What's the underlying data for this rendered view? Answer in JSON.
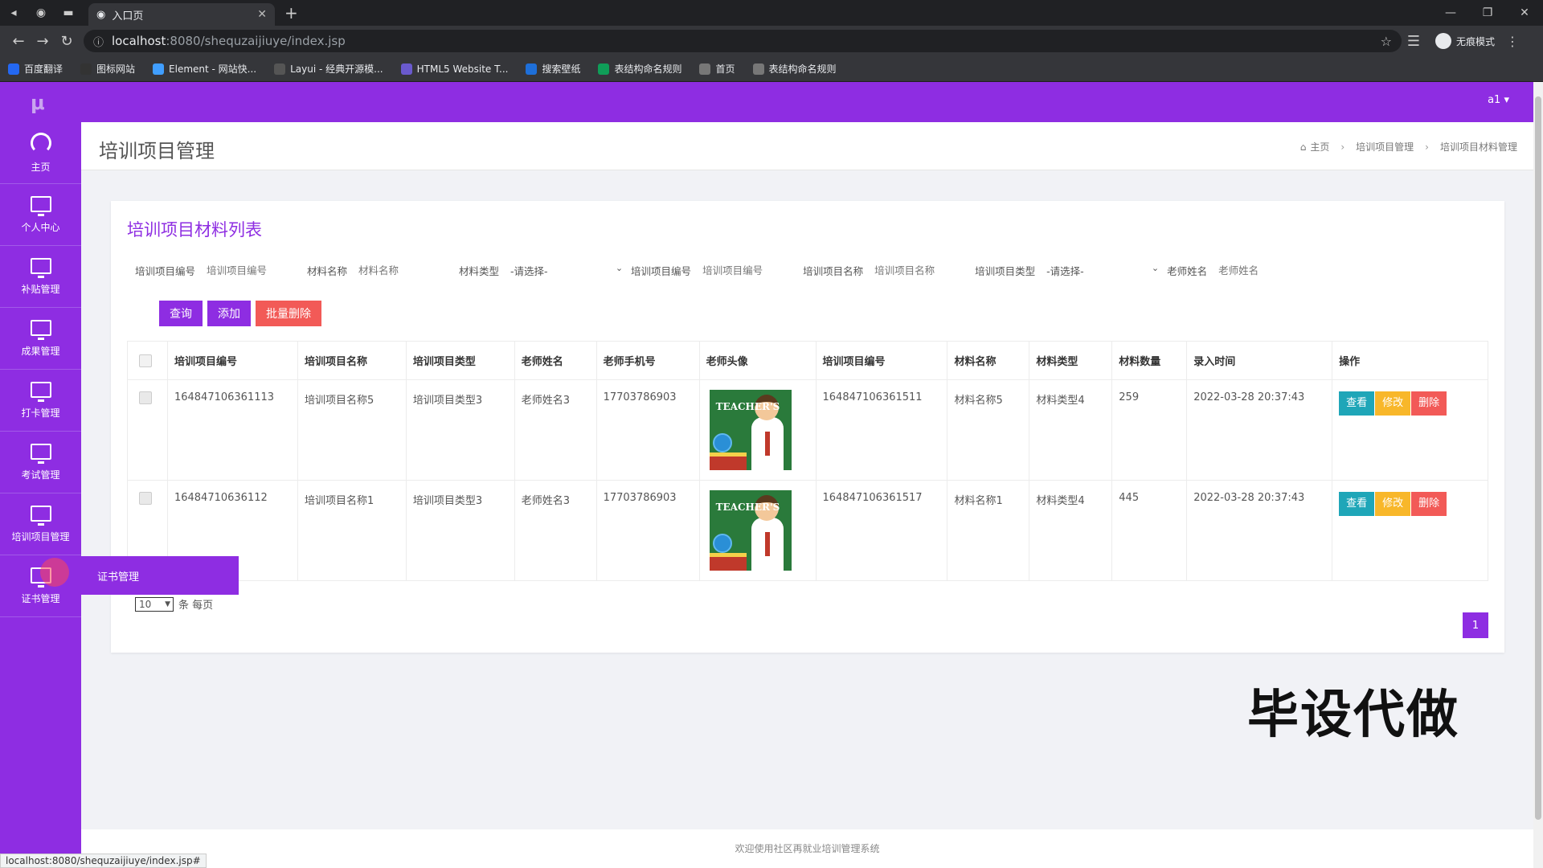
{
  "browser": {
    "tab_title": "入口页",
    "url_host": "localhost",
    "url_path": ":8080/shequzaijiuye/index.jsp",
    "incognito_label": "无痕模式",
    "status_url": "localhost:8080/shequzaijiuye/index.jsp#",
    "bookmarks": [
      {
        "label": "百度翻译",
        "color": "#2468f2"
      },
      {
        "label": "图标网站",
        "color": "#333333"
      },
      {
        "label": "Element - 网站快...",
        "color": "#409eff"
      },
      {
        "label": "Layui - 经典开源模...",
        "color": "#555555"
      },
      {
        "label": "HTML5 Website T...",
        "color": "#6a5acd"
      },
      {
        "label": "搜索壁纸",
        "color": "#1e6fd9"
      },
      {
        "label": "表结构命名规则",
        "color": "#0f9d58"
      },
      {
        "label": "首页",
        "color": "#777777"
      },
      {
        "label": "表结构命名规则",
        "color": "#777777"
      }
    ]
  },
  "app": {
    "logo": "μ",
    "user": "a1 ▾",
    "accent_color": "#8e2de2",
    "sidebar": [
      {
        "label": "主页",
        "icon": "dashboard-icon"
      },
      {
        "label": "个人中心",
        "icon": "monitor-icon"
      },
      {
        "label": "补贴管理",
        "icon": "monitor-icon"
      },
      {
        "label": "成果管理",
        "icon": "monitor-icon"
      },
      {
        "label": "打卡管理",
        "icon": "monitor-icon"
      },
      {
        "label": "考试管理",
        "icon": "monitor-icon"
      },
      {
        "label": "培训项目管理",
        "icon": "monitor-icon"
      },
      {
        "label": "证书管理",
        "icon": "monitor-icon"
      }
    ],
    "flyout_item": "证书管理",
    "page_title": "培训项目管理",
    "breadcrumb": [
      "主页",
      "培训项目管理",
      "培训项目材料管理"
    ],
    "card_title": "培训项目材料列表",
    "search": {
      "fields": [
        {
          "label": "培训项目编号",
          "placeholder": "培训项目编号",
          "type": "input"
        },
        {
          "label": "材料名称",
          "placeholder": "材料名称",
          "type": "input"
        },
        {
          "label": "材料类型",
          "value": "-请选择-",
          "type": "select"
        },
        {
          "label": "培训项目编号",
          "placeholder": "培训项目编号",
          "type": "input"
        },
        {
          "label": "培训项目名称",
          "placeholder": "培训项目名称",
          "type": "input"
        },
        {
          "label": "培训项目类型",
          "value": "-请选择-",
          "type": "select"
        },
        {
          "label": "老师姓名",
          "placeholder": "老师姓名",
          "type": "input"
        }
      ]
    },
    "buttons": {
      "query": "查询",
      "add": "添加",
      "batch_delete": "批量删除"
    },
    "table": {
      "headers": [
        "培训项目编号",
        "培训项目名称",
        "培训项目类型",
        "老师姓名",
        "老师手机号",
        "老师头像",
        "培训项目编号",
        "材料名称",
        "材料类型",
        "材料数量",
        "录入时间",
        "操作"
      ],
      "rows": [
        {
          "project_no": "164847106361113",
          "project_name": "培训项目名称5",
          "project_type": "培训项目类型3",
          "teacher": "老师姓名3",
          "phone": "17703786903",
          "project_no2": "164847106361511",
          "material_name": "材料名称5",
          "material_type": "材料类型4",
          "qty": "259",
          "time": "2022-03-28 20:37:43"
        },
        {
          "project_no": "16484710636112",
          "project_name": "培训项目名称1",
          "project_type": "培训项目类型3",
          "teacher": "老师姓名3",
          "phone": "17703786903",
          "project_no2": "164847106361517",
          "material_name": "材料名称1",
          "material_type": "材料类型4",
          "qty": "445",
          "time": "2022-03-28 20:37:43"
        }
      ],
      "avatar_text": "TEACHER'S",
      "actions": {
        "view": "查看",
        "edit": "修改",
        "delete": "删除"
      }
    },
    "pager": {
      "page_size": "10",
      "per_page_label": "条 每页",
      "current_page": "1"
    },
    "footer": "欢迎使用社区再就业培训管理系统"
  },
  "watermark": "毕设代做"
}
